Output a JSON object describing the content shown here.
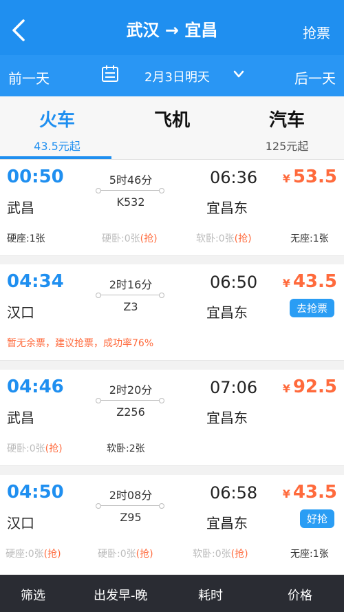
{
  "header": {
    "title": "武汉 → 宜昌",
    "grab_label": "抢票",
    "prev_day": "前一天",
    "date": "2月3日明天",
    "next_day": "后一天",
    "accent": "#1f8ff0"
  },
  "tabs": [
    {
      "label": "火车",
      "sub": "43.5元起"
    },
    {
      "label": "飞机",
      "sub": ""
    },
    {
      "label": "汽车",
      "sub": "125元起"
    }
  ],
  "trains": [
    {
      "dep": "00:50",
      "from": "武昌",
      "duration": "5时46分",
      "train_no": "K532",
      "arr": "06:36",
      "to": "宜昌东",
      "currency": "¥",
      "price": "53.5",
      "badge": "",
      "seats": [
        {
          "name": "硬座:1张",
          "dim": false,
          "grab": ""
        },
        {
          "name": "硬卧:0张",
          "dim": true,
          "grab": "(抢)"
        },
        {
          "name": "软卧:0张",
          "dim": true,
          "grab": "(抢)"
        },
        {
          "name": "无座:1张",
          "dim": false,
          "grab": ""
        }
      ],
      "notice": ""
    },
    {
      "dep": "04:34",
      "from": "汉口",
      "duration": "2时16分",
      "train_no": "Z3",
      "arr": "06:50",
      "to": "宜昌东",
      "currency": "¥",
      "price": "43.5",
      "badge": "去抢票",
      "seats": [],
      "notice": "暂无余票，建议抢票，成功率76%"
    },
    {
      "dep": "04:46",
      "from": "武昌",
      "duration": "2时20分",
      "train_no": "Z256",
      "arr": "07:06",
      "to": "宜昌东",
      "currency": "¥",
      "price": "92.5",
      "badge": "",
      "seats": [
        {
          "name": "硬卧:0张",
          "dim": true,
          "grab": "(抢)"
        },
        {
          "name": "软卧:2张",
          "dim": false,
          "grab": ""
        }
      ],
      "notice": ""
    },
    {
      "dep": "04:50",
      "from": "汉口",
      "duration": "2时08分",
      "train_no": "Z95",
      "arr": "06:58",
      "to": "宜昌东",
      "currency": "¥",
      "price": "43.5",
      "badge": "好抢",
      "seats": [
        {
          "name": "硬座:0张",
          "dim": true,
          "grab": "(抢)"
        },
        {
          "name": "硬卧:0张",
          "dim": true,
          "grab": "(抢)"
        },
        {
          "name": "软卧:0张",
          "dim": true,
          "grab": "(抢)"
        },
        {
          "name": "无座:1张",
          "dim": false,
          "grab": ""
        }
      ],
      "notice": ""
    }
  ],
  "bottom": {
    "filter": "筛选",
    "sort_time": "出发早-晚",
    "duration": "耗时",
    "price": "价格"
  }
}
